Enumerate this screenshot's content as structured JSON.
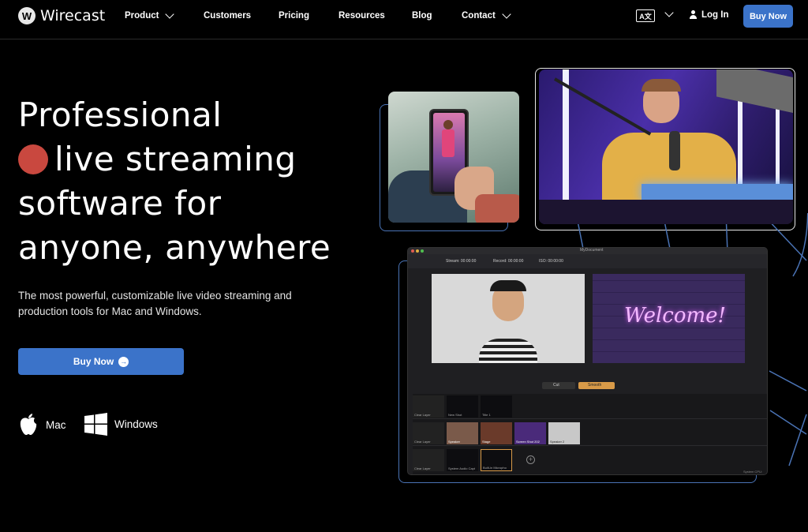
{
  "nav": {
    "brand": "Wirecast",
    "items": [
      {
        "label": "Product",
        "dropdown": true
      },
      {
        "label": "Customers",
        "dropdown": false
      },
      {
        "label": "Pricing",
        "dropdown": false
      },
      {
        "label": "Resources",
        "dropdown": false
      },
      {
        "label": "Blog",
        "dropdown": false
      },
      {
        "label": "Contact",
        "dropdown": true
      }
    ],
    "login": "Log In",
    "buy_now": "Buy Now",
    "lang_icon_text": "A文"
  },
  "hero": {
    "headline": [
      "Professional",
      "live streaming",
      "software for",
      "anyone, anywhere"
    ],
    "subtitle": "The most powerful, customizable live video streaming and production tools for Mac and Windows.",
    "cta": "Buy Now",
    "platforms": [
      {
        "label": "Mac",
        "icon": "apple-icon"
      },
      {
        "label": "Windows",
        "icon": "windows-icon"
      }
    ]
  },
  "app": {
    "title": "MyDocument",
    "stream": "Stream: 00:00:00",
    "record": "Record: 00:00:00",
    "iso": "ISO: 00:00:00",
    "transition": "Cut",
    "smooth": "Smooth",
    "welcome": "Welcome!",
    "status": "System CPU:",
    "layers": [
      {
        "shots": [
          "Clear Layer",
          "New Shot",
          "Title 1"
        ]
      },
      {
        "shots": [
          "Clear Layer",
          "Speaker",
          "Stage",
          "Screen Shot 202",
          "Speaker 2"
        ]
      },
      {
        "shots": [
          "Clear Layer",
          "System Audio Capt",
          "Built-in Micropho"
        ]
      }
    ]
  },
  "colors": {
    "accent": "#3b73c9",
    "dot": "#c9483f",
    "background": "#000000"
  }
}
